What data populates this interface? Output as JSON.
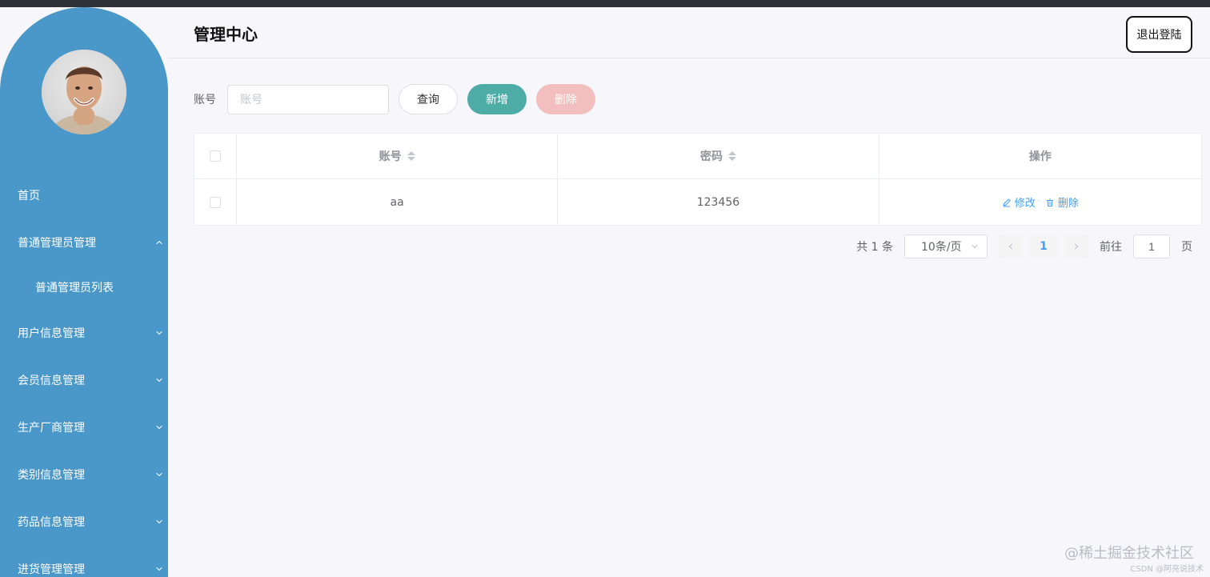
{
  "header": {
    "title": "管理中心",
    "logout_label": "退出登陆"
  },
  "sidebar": {
    "avatar": "avatar-photo",
    "items": [
      {
        "label": "首页",
        "type": "item",
        "icon": ""
      },
      {
        "label": "普通管理员管理",
        "type": "group",
        "expanded": true,
        "icon": "chevron-up-icon"
      },
      {
        "label": "普通管理员列表",
        "type": "sub",
        "icon": ""
      },
      {
        "label": "用户信息管理",
        "type": "group",
        "expanded": false,
        "icon": "chevron-down-icon"
      },
      {
        "label": "会员信息管理",
        "type": "group",
        "expanded": false,
        "icon": "chevron-down-icon"
      },
      {
        "label": "生产厂商管理",
        "type": "group",
        "expanded": false,
        "icon": "chevron-down-icon"
      },
      {
        "label": "类别信息管理",
        "type": "group",
        "expanded": false,
        "icon": "chevron-down-icon"
      },
      {
        "label": "药品信息管理",
        "type": "group",
        "expanded": false,
        "icon": "chevron-down-icon"
      },
      {
        "label": "进货管理管理",
        "type": "group",
        "expanded": false,
        "icon": "chevron-down-icon"
      }
    ]
  },
  "search": {
    "label": "账号",
    "placeholder": "账号",
    "value": "",
    "query_label": "查询",
    "add_label": "新增",
    "delete_label": "删除"
  },
  "table": {
    "columns": [
      "账号",
      "密码",
      "操作"
    ],
    "rows": [
      {
        "account": "aa",
        "password": "123456",
        "edit_label": "修改",
        "delete_label": "删除"
      }
    ]
  },
  "pagination": {
    "total_text": "共 1 条",
    "page_size": "10条/页",
    "current_page": "1",
    "goto_label": "前往",
    "goto_value": "1",
    "page_suffix": "页"
  },
  "watermark": {
    "main": "@稀土掘金技术社区",
    "small": "CSDN @阿亮说技术"
  },
  "colors": {
    "sidebar": "#4a97c9",
    "add_button": "#4eaca7",
    "delete_button_disabled": "#f3bebe",
    "link": "#409eff"
  }
}
